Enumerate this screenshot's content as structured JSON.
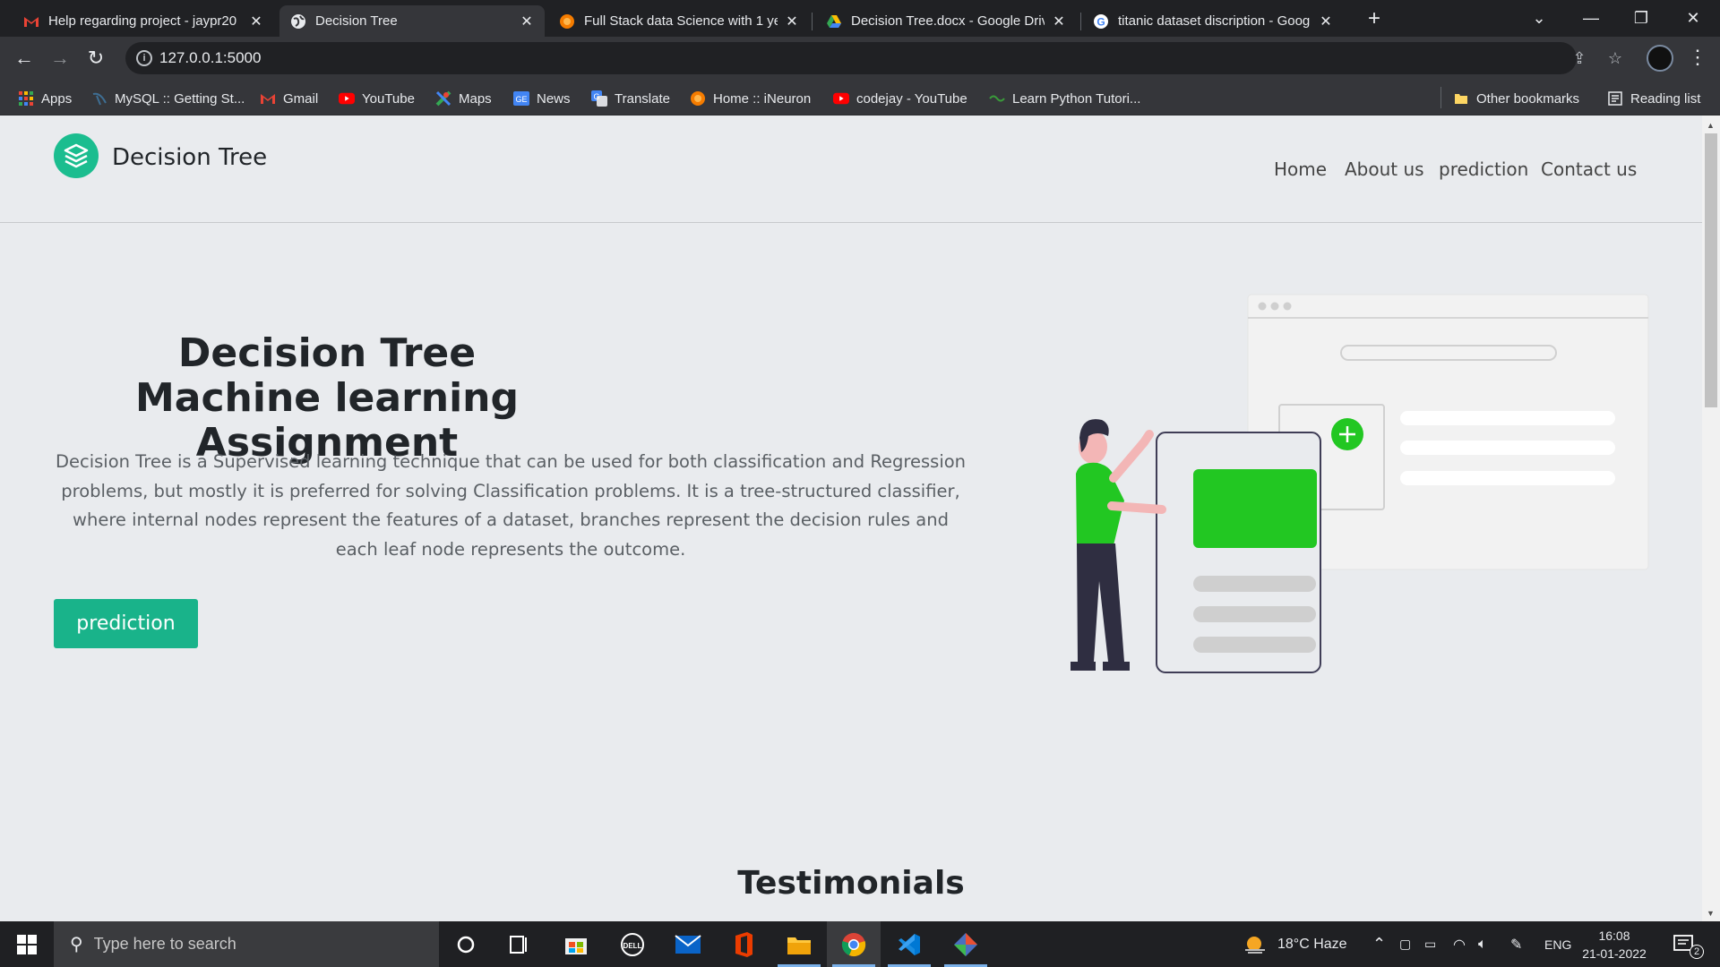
{
  "browser": {
    "tabs": [
      {
        "title": "Help regarding project - jaypr20",
        "favicon": "gmail-icon",
        "active": false
      },
      {
        "title": "Decision Tree",
        "favicon": "globe-icon",
        "active": true
      },
      {
        "title": "Full Stack data Science with 1 yea",
        "favicon": "ineuron-icon",
        "active": false
      },
      {
        "title": "Decision Tree.docx - Google Driv",
        "favicon": "google-drive-icon",
        "active": false
      },
      {
        "title": "titanic dataset discription - Goog",
        "favicon": "google-icon",
        "active": false
      }
    ],
    "url": "127.0.0.1:5000",
    "bookmarks": [
      {
        "label": "Apps",
        "icon": "apps-grid-icon"
      },
      {
        "label": "MySQL :: Getting St...",
        "icon": "mysql-icon"
      },
      {
        "label": "Gmail",
        "icon": "gmail-icon"
      },
      {
        "label": "YouTube",
        "icon": "youtube-icon"
      },
      {
        "label": "Maps",
        "icon": "maps-icon"
      },
      {
        "label": "News",
        "icon": "news-icon"
      },
      {
        "label": "Translate",
        "icon": "translate-icon"
      },
      {
        "label": "Home :: iNeuron",
        "icon": "ineuron-icon"
      },
      {
        "label": "codejay - YouTube",
        "icon": "youtube-icon"
      },
      {
        "label": "Learn Python Tutori...",
        "icon": "python-icon"
      }
    ],
    "other_bookmarks": "Other bookmarks",
    "reading_list": "Reading list"
  },
  "site": {
    "brand": "Decision Tree",
    "nav": [
      "Home",
      "About us",
      "prediction",
      "Contact us"
    ],
    "hero": {
      "title_line1": "Decision Tree",
      "title_line2": "Machine learning Assignment",
      "description": "Decision Tree is a Supervised learning technique that can be used for both classification and Regression problems, but mostly it is preferred for solving Classification problems. It is a tree-structured classifier, where internal nodes represent the features of a dataset, branches represent the decision rules and each leaf node represents the outcome.",
      "cta_label": "prediction"
    },
    "testimonials_heading": "Testimonials",
    "colors": {
      "accent": "#19b38a",
      "illustration_green": "#22c722",
      "background": "#e9ebee"
    }
  },
  "taskbar": {
    "search_placeholder": "Type here to search",
    "weather": "18°C  Haze",
    "language": "ENG",
    "time": "16:08",
    "date": "21-01-2022",
    "notifications": "2"
  }
}
